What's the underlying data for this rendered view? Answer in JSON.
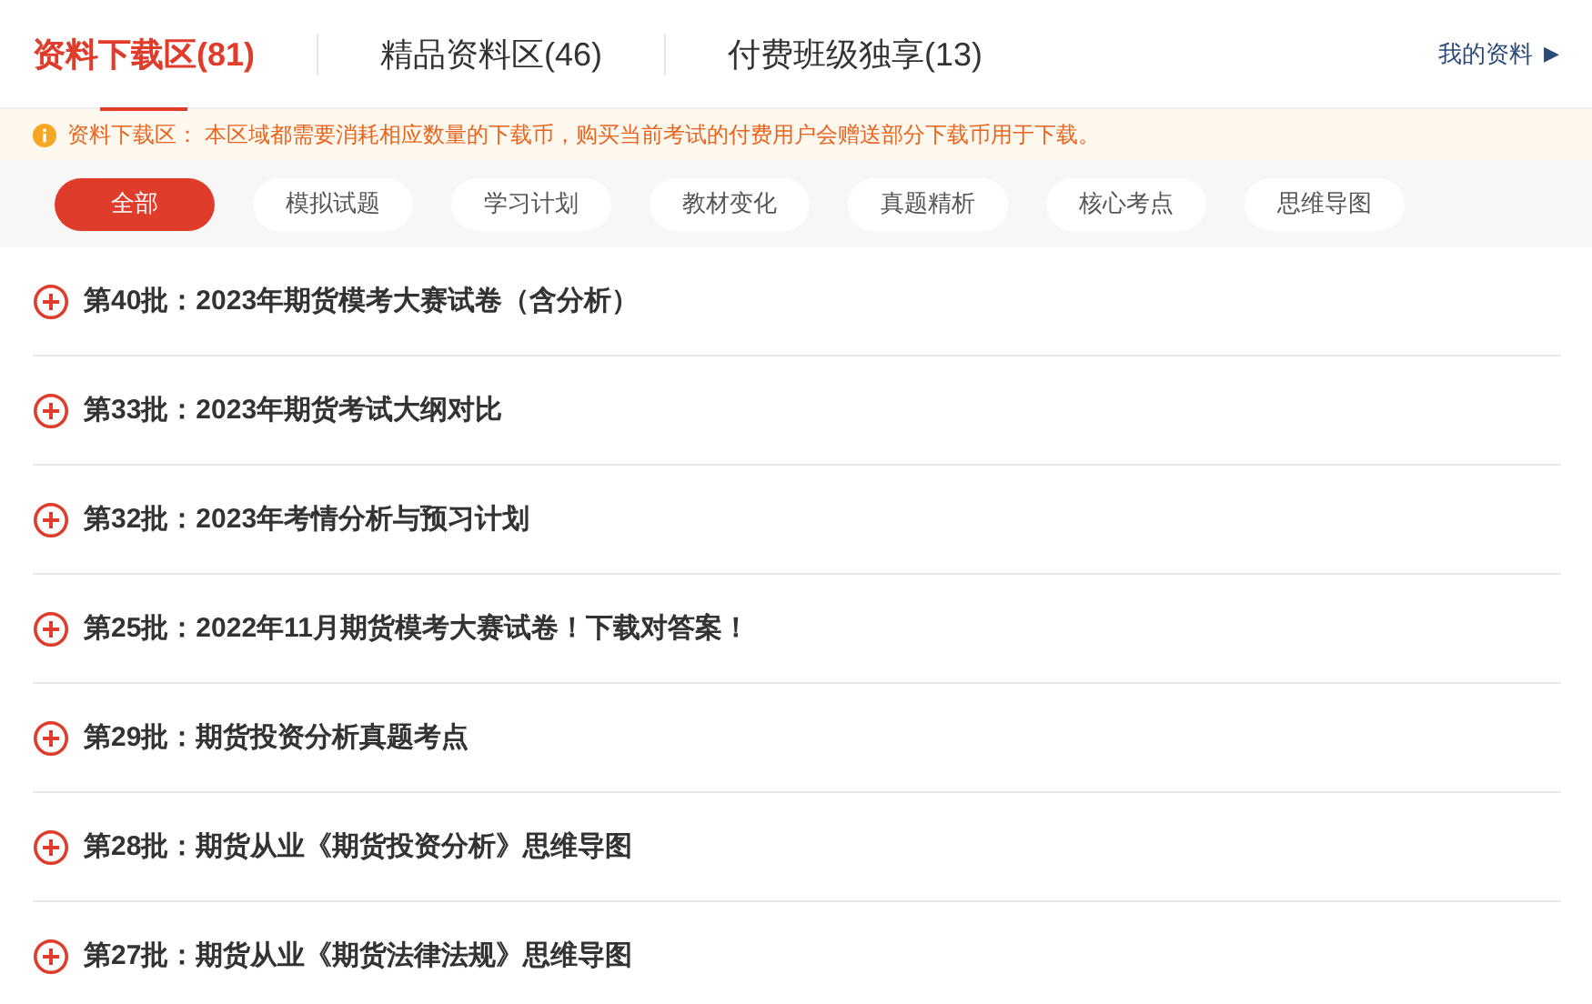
{
  "tabs": [
    {
      "label": "资料下载区(81)",
      "selected": true
    },
    {
      "label": "精品资料区(46)",
      "selected": false
    },
    {
      "label": "付费班级独享(13)",
      "selected": false
    }
  ],
  "my_materials_link": {
    "label": "我的资料",
    "arrow": "▶"
  },
  "notice": {
    "title": "资料下载区：",
    "text": "本区域都需要消耗相应数量的下载币，购买当前考试的付费用户会赠送部分下载币用于下载。"
  },
  "filters": [
    {
      "label": "全部",
      "selected": true
    },
    {
      "label": "模拟试题",
      "selected": false
    },
    {
      "label": "学习计划",
      "selected": false
    },
    {
      "label": "教材变化",
      "selected": false
    },
    {
      "label": "真题精析",
      "selected": false
    },
    {
      "label": "核心考点",
      "selected": false
    },
    {
      "label": "思维导图",
      "selected": false
    }
  ],
  "items": [
    {
      "title": "第40批：2023年期货模考大赛试卷（含分析）",
      "expanded": false
    },
    {
      "title": "第33批：2023年期货考试大纲对比",
      "expanded": false
    },
    {
      "title": "第32批：2023年考情分析与预习计划",
      "expanded": false
    },
    {
      "title": "第25批：2022年11月期货模考大赛试卷！下载对答案！",
      "expanded": false
    },
    {
      "title": "第29批：期货投资分析真题考点",
      "expanded": false
    },
    {
      "title": "第28批：期货从业《期货投资分析》思维导图",
      "expanded": false
    },
    {
      "title": "第27批：期货从业《期货法律法规》思维导图",
      "expanded": false
    }
  ]
}
